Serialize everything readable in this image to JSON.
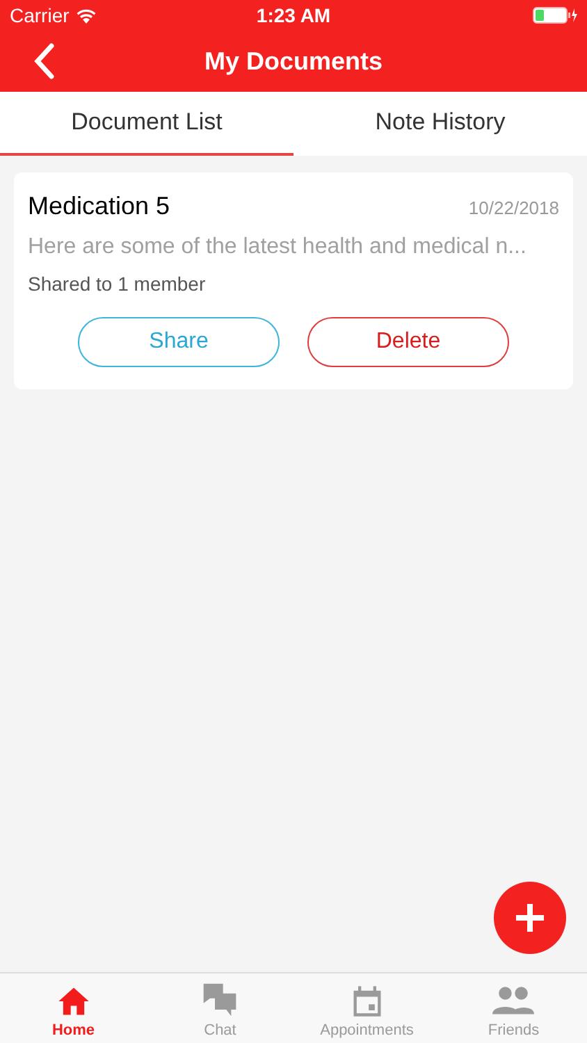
{
  "status_bar": {
    "carrier": "Carrier",
    "time": "1:23 AM"
  },
  "header": {
    "title": "My Documents"
  },
  "tabs": [
    {
      "label": "Document List",
      "selected": true
    },
    {
      "label": "Note History",
      "selected": false
    }
  ],
  "documents": [
    {
      "title": "Medication 5",
      "date": "10/22/2018",
      "preview": "Here are some of the latest health and medical n...",
      "shared": "Shared to 1 member",
      "actions": [
        {
          "label": "Share",
          "kind": "share"
        },
        {
          "label": "Delete",
          "kind": "delete"
        }
      ]
    }
  ],
  "bottom_nav": [
    {
      "label": "Home",
      "kind": "home",
      "selected": true
    },
    {
      "label": "Chat",
      "kind": "chat",
      "selected": false
    },
    {
      "label": "Appointments",
      "kind": "calendar",
      "selected": false
    },
    {
      "label": "Friends",
      "kind": "friends",
      "selected": false
    }
  ]
}
